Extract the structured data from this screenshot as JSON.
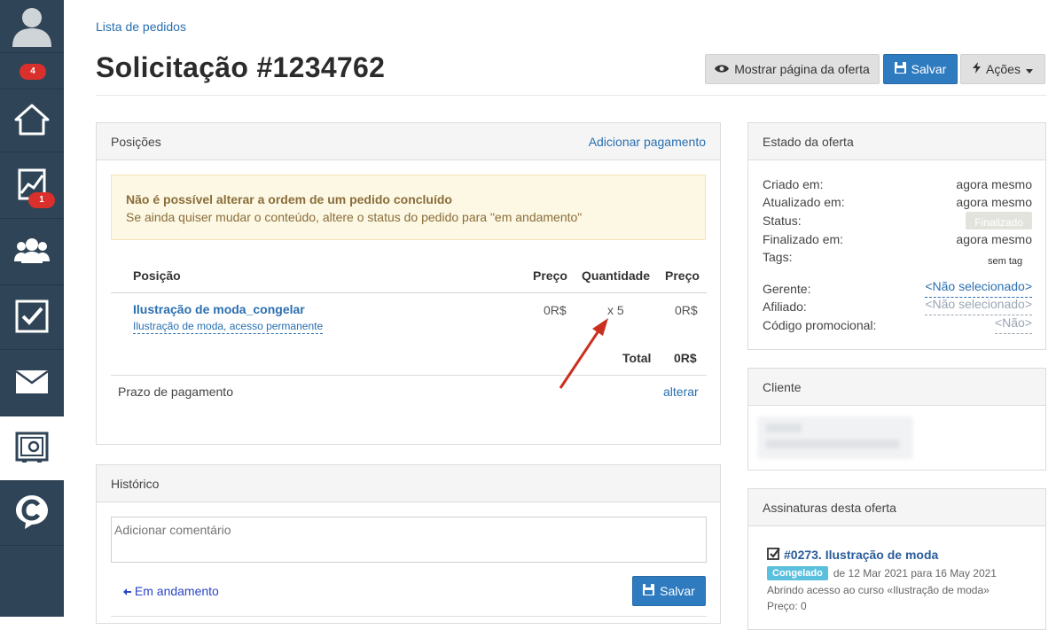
{
  "sidebar": {
    "badges": {
      "user": "4",
      "analytics": "1"
    },
    "icons": [
      "user-avatar-icon",
      "home-icon",
      "chart-icon",
      "users-icon",
      "checkbox-icon",
      "mail-icon",
      "safe-icon",
      "logo-icon"
    ]
  },
  "header": {
    "breadcrumb": "Lista de pedidos",
    "title": "Solicitação #1234762",
    "btn_show": "Mostrar página da oferta",
    "btn_save": "Salvar",
    "btn_actions": "Ações"
  },
  "positions": {
    "title": "Posições",
    "add_payment": "Adicionar pagamento",
    "alert_title": "Não é possível alterar a ordem de um pedido concluído",
    "alert_text": "Se ainda quiser mudar o conteúdo, altere o status do pedido para \"em andamento\"",
    "col_position": "Posição",
    "col_price": "Preço",
    "col_qty": "Quantidade",
    "col_price2": "Preço",
    "item_name": "Ilustração de moda_congelar",
    "item_sub": "Ilustração de moda, acesso permanente",
    "item_price": "0R$",
    "item_qty": "x 5",
    "item_total": "0R$",
    "total_label": "Total",
    "total_value": "0R$",
    "deadline_label": "Prazo de pagamento",
    "deadline_link": "alterar"
  },
  "history": {
    "title": "Histórico",
    "comment_placeholder": "Adicionar comentário",
    "status_link": "Em andamento",
    "save": "Salvar"
  },
  "state": {
    "title": "Estado da oferta",
    "created_label": "Criado em:",
    "created_value": "agora mesmo",
    "updated_label": "Atualizado em:",
    "updated_value": "agora mesmo",
    "status_label": "Status:",
    "status_value": "Finalizado",
    "finished_label": "Finalizado em:",
    "finished_value": "agora mesmo",
    "tags_label": "Tags:",
    "tags_value": "sem tag",
    "manager_label": "Gerente:",
    "manager_value": "<Não selecionado>",
    "affiliate_label": "Afiliado:",
    "affiliate_value": "<Não selecionado>",
    "promo_label": "Código promocional:",
    "promo_value": "<Não>"
  },
  "client": {
    "title": "Cliente"
  },
  "subscriptions": {
    "title": "Assinaturas desta oferta",
    "item_title": "#0273. Ilustração de moda",
    "badge": "Congelado",
    "period": "de 12 Mar 2021 para 16 May 2021",
    "desc": "Abrindo acesso ao curso «Ilustração de moda»",
    "price": "Preço: 0"
  }
}
